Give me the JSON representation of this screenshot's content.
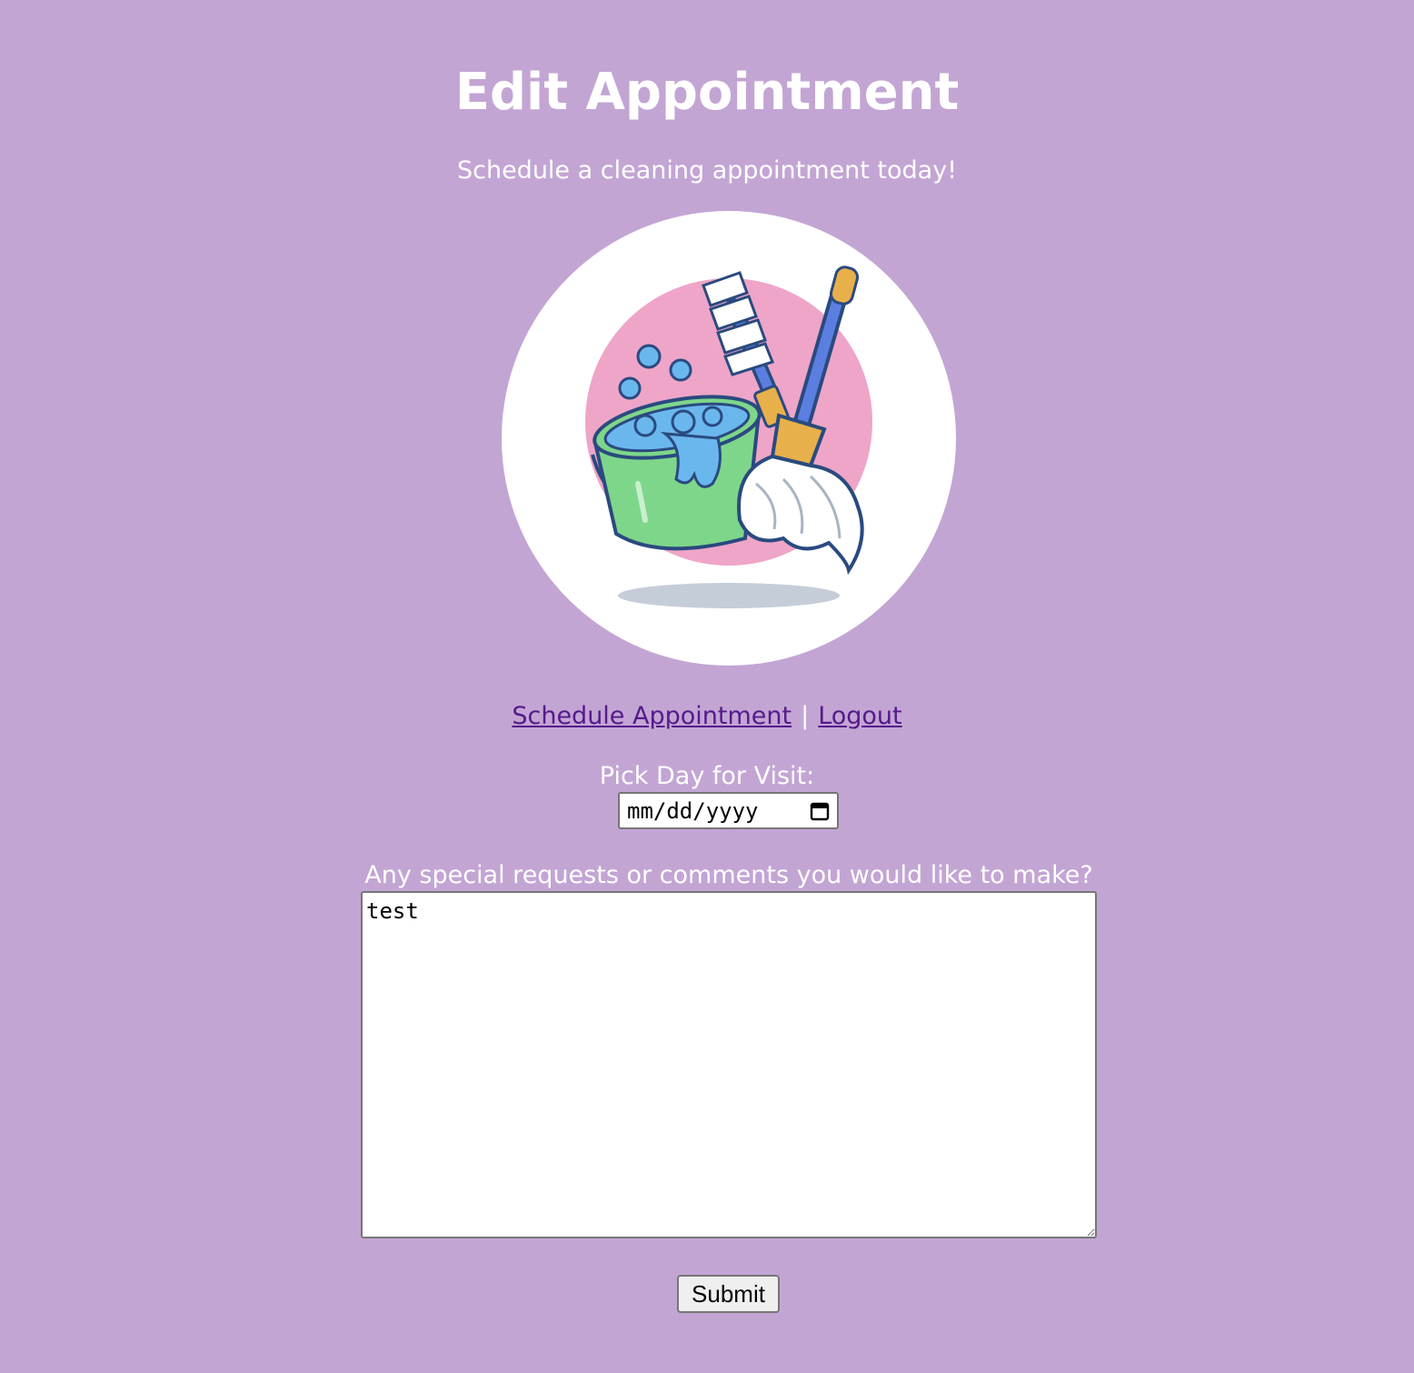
{
  "header": {
    "title": "Edit Appointment",
    "subtitle": "Schedule a cleaning appointment today!"
  },
  "logo": {
    "icon": "cleaning-supplies-icon"
  },
  "nav": {
    "schedule_label": "Schedule Appointment",
    "separator": "|",
    "logout_label": "Logout"
  },
  "form": {
    "date_label": "Pick Day for Visit:",
    "date_placeholder": "mm/dd/yyyy",
    "comments_label": "Any special requests or comments you would like to make?",
    "comments_value": "test",
    "submit_label": "Submit"
  },
  "colors": {
    "background": "#c3a5d4",
    "link": "#551a8b",
    "text": "#ffffff"
  }
}
